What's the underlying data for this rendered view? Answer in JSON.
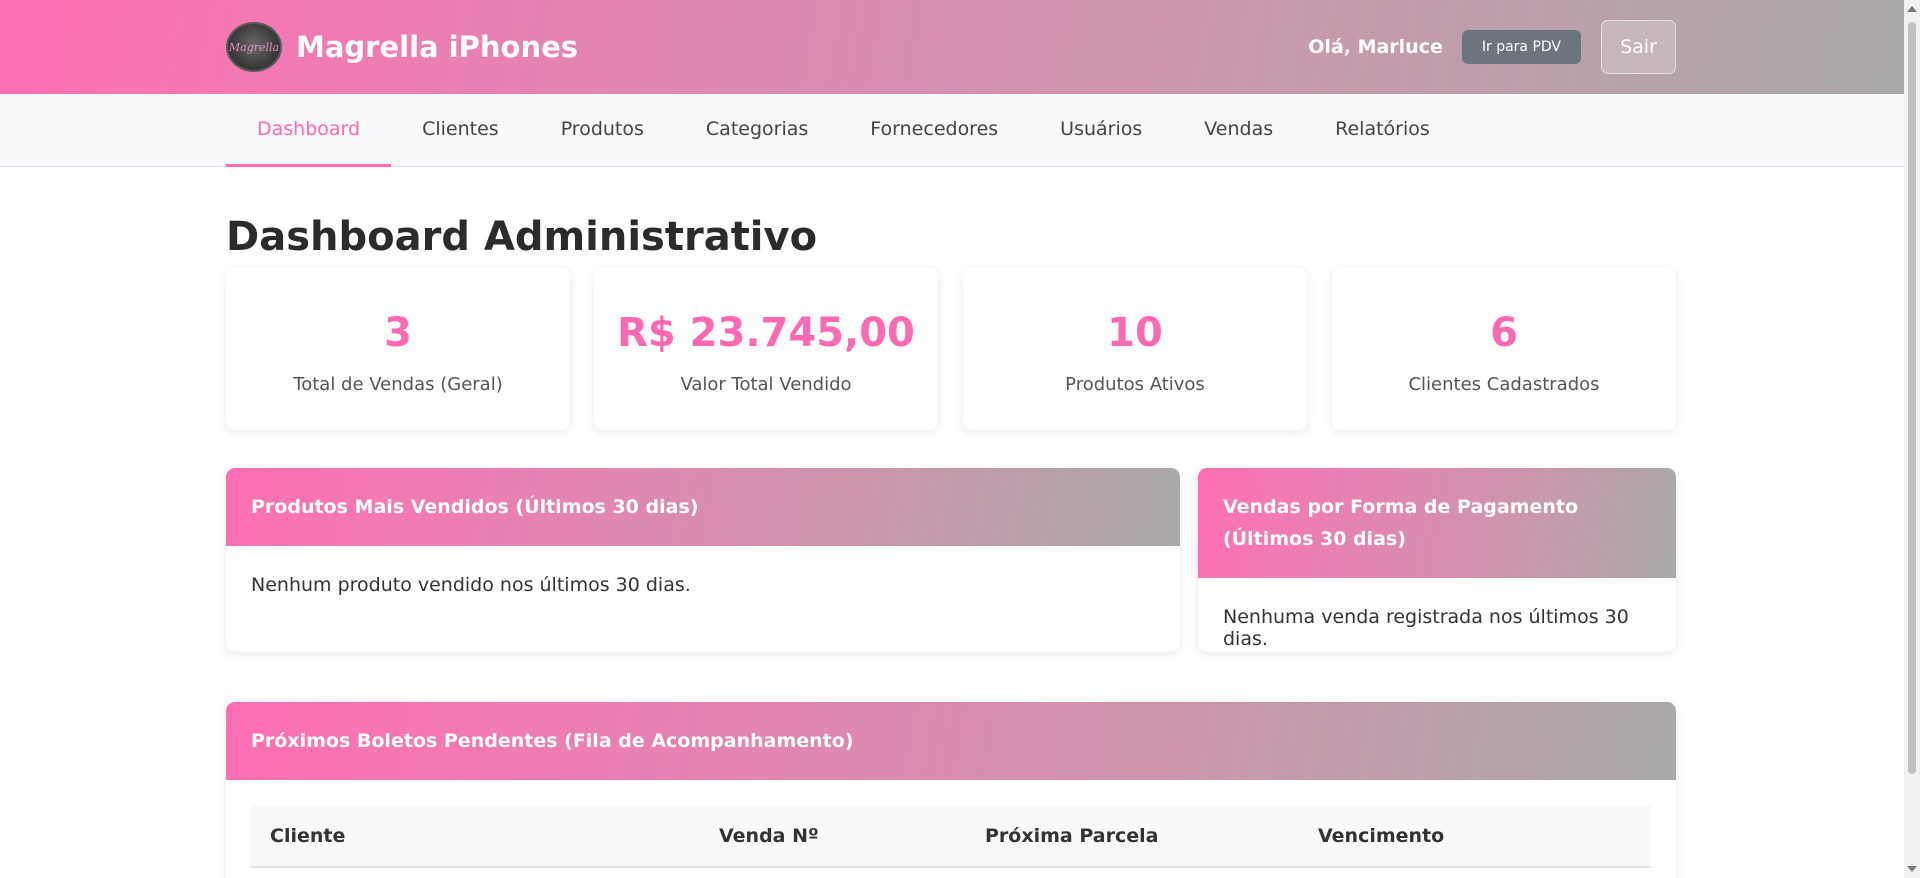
{
  "header": {
    "brand": "Magrella iPhones",
    "logo_text": "Magrella",
    "greeting": "Olá, Marluce",
    "pdv_label": "Ir para PDV",
    "logout_label": "Sair"
  },
  "nav": {
    "items": [
      {
        "label": "Dashboard",
        "active": true
      },
      {
        "label": "Clientes"
      },
      {
        "label": "Produtos"
      },
      {
        "label": "Categorias"
      },
      {
        "label": "Fornecedores"
      },
      {
        "label": "Usuários"
      },
      {
        "label": "Vendas"
      },
      {
        "label": "Relatórios"
      }
    ]
  },
  "page": {
    "title": "Dashboard Administrativo"
  },
  "stats": [
    {
      "value": "3",
      "label": "Total de Vendas (Geral)"
    },
    {
      "value": "R$ 23.745,00",
      "label": "Valor Total Vendido"
    },
    {
      "value": "10",
      "label": "Produtos Ativos"
    },
    {
      "value": "6",
      "label": "Clientes Cadastrados"
    }
  ],
  "top_products": {
    "title": "Produtos Mais Vendidos (Últimos 30 dias)",
    "empty": "Nenhum produto vendido nos últimos 30 dias."
  },
  "payment_methods": {
    "title": "Vendas por Forma de Pagamento (Últimos 30 dias)",
    "empty": "Nenhuma venda registrada nos últimos 30 dias."
  },
  "boletos": {
    "title": "Próximos Boletos Pendentes (Fila de Acompanhamento)",
    "columns": [
      "Cliente",
      "Venda Nº",
      "Próxima Parcela",
      "Vencimento"
    ]
  },
  "colors": {
    "accent": "#ff69b4",
    "gradient_start": "#ff6fb5",
    "gradient_end": "#a9a9a9"
  }
}
